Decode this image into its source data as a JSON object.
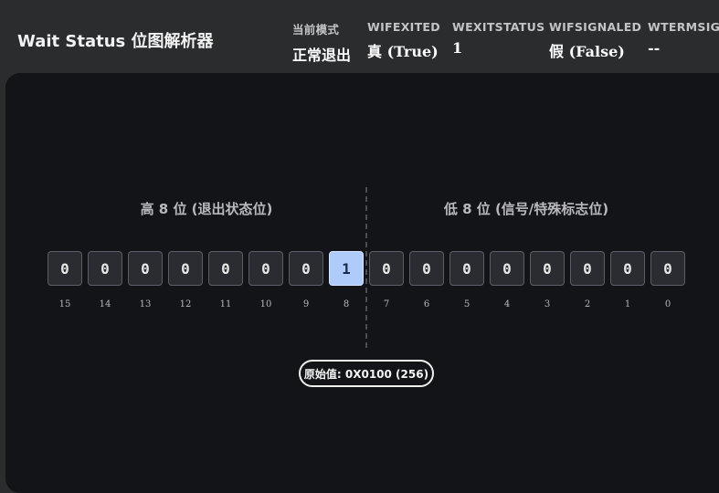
{
  "header": {
    "title": "Wait Status 位图解析器",
    "stats": [
      {
        "label": "当前模式",
        "value": "正常退出"
      },
      {
        "label": "WIFEXITED",
        "value": "真 (True)"
      },
      {
        "label": "WEXITSTATUS",
        "value": "1"
      },
      {
        "label": "WIFSIGNALED",
        "value": "假 (False)"
      },
      {
        "label": "WTERMSIG",
        "value": "--"
      }
    ]
  },
  "sections": {
    "high_title": "高 8 位 (退出状态位)",
    "low_title": "低 8 位 (信号/特殊标志位)"
  },
  "bits": [
    {
      "index": "15",
      "value": "0",
      "on": false
    },
    {
      "index": "14",
      "value": "0",
      "on": false
    },
    {
      "index": "13",
      "value": "0",
      "on": false
    },
    {
      "index": "12",
      "value": "0",
      "on": false
    },
    {
      "index": "11",
      "value": "0",
      "on": false
    },
    {
      "index": "10",
      "value": "0",
      "on": false
    },
    {
      "index": "9",
      "value": "0",
      "on": false
    },
    {
      "index": "8",
      "value": "1",
      "on": true
    },
    {
      "index": "7",
      "value": "0",
      "on": false
    },
    {
      "index": "6",
      "value": "0",
      "on": false
    },
    {
      "index": "5",
      "value": "0",
      "on": false
    },
    {
      "index": "4",
      "value": "0",
      "on": false
    },
    {
      "index": "3",
      "value": "0",
      "on": false
    },
    {
      "index": "2",
      "value": "0",
      "on": false
    },
    {
      "index": "1",
      "value": "0",
      "on": false
    },
    {
      "index": "0",
      "value": "0",
      "on": false
    }
  ],
  "raw": {
    "text": "原始值: 0X0100 (256)"
  },
  "colors": {
    "bit_on": "#aecbfa",
    "bit_off": "#2a2c31",
    "panel": "#131418",
    "header": "#2b2c2e"
  }
}
